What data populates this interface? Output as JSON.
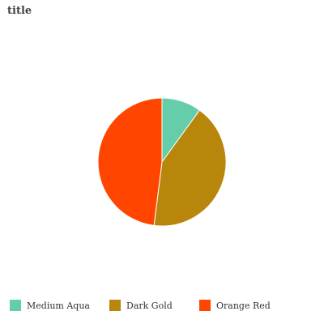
{
  "chart_data": {
    "type": "pie",
    "title": "title",
    "categories": [
      "Medium Aqua",
      "Dark Gold",
      "Orange Red"
    ],
    "values": [
      10,
      42,
      48
    ],
    "colors": [
      "#66cdaa",
      "#b8860b",
      "#ff4500"
    ],
    "legend_position": "bottom"
  }
}
